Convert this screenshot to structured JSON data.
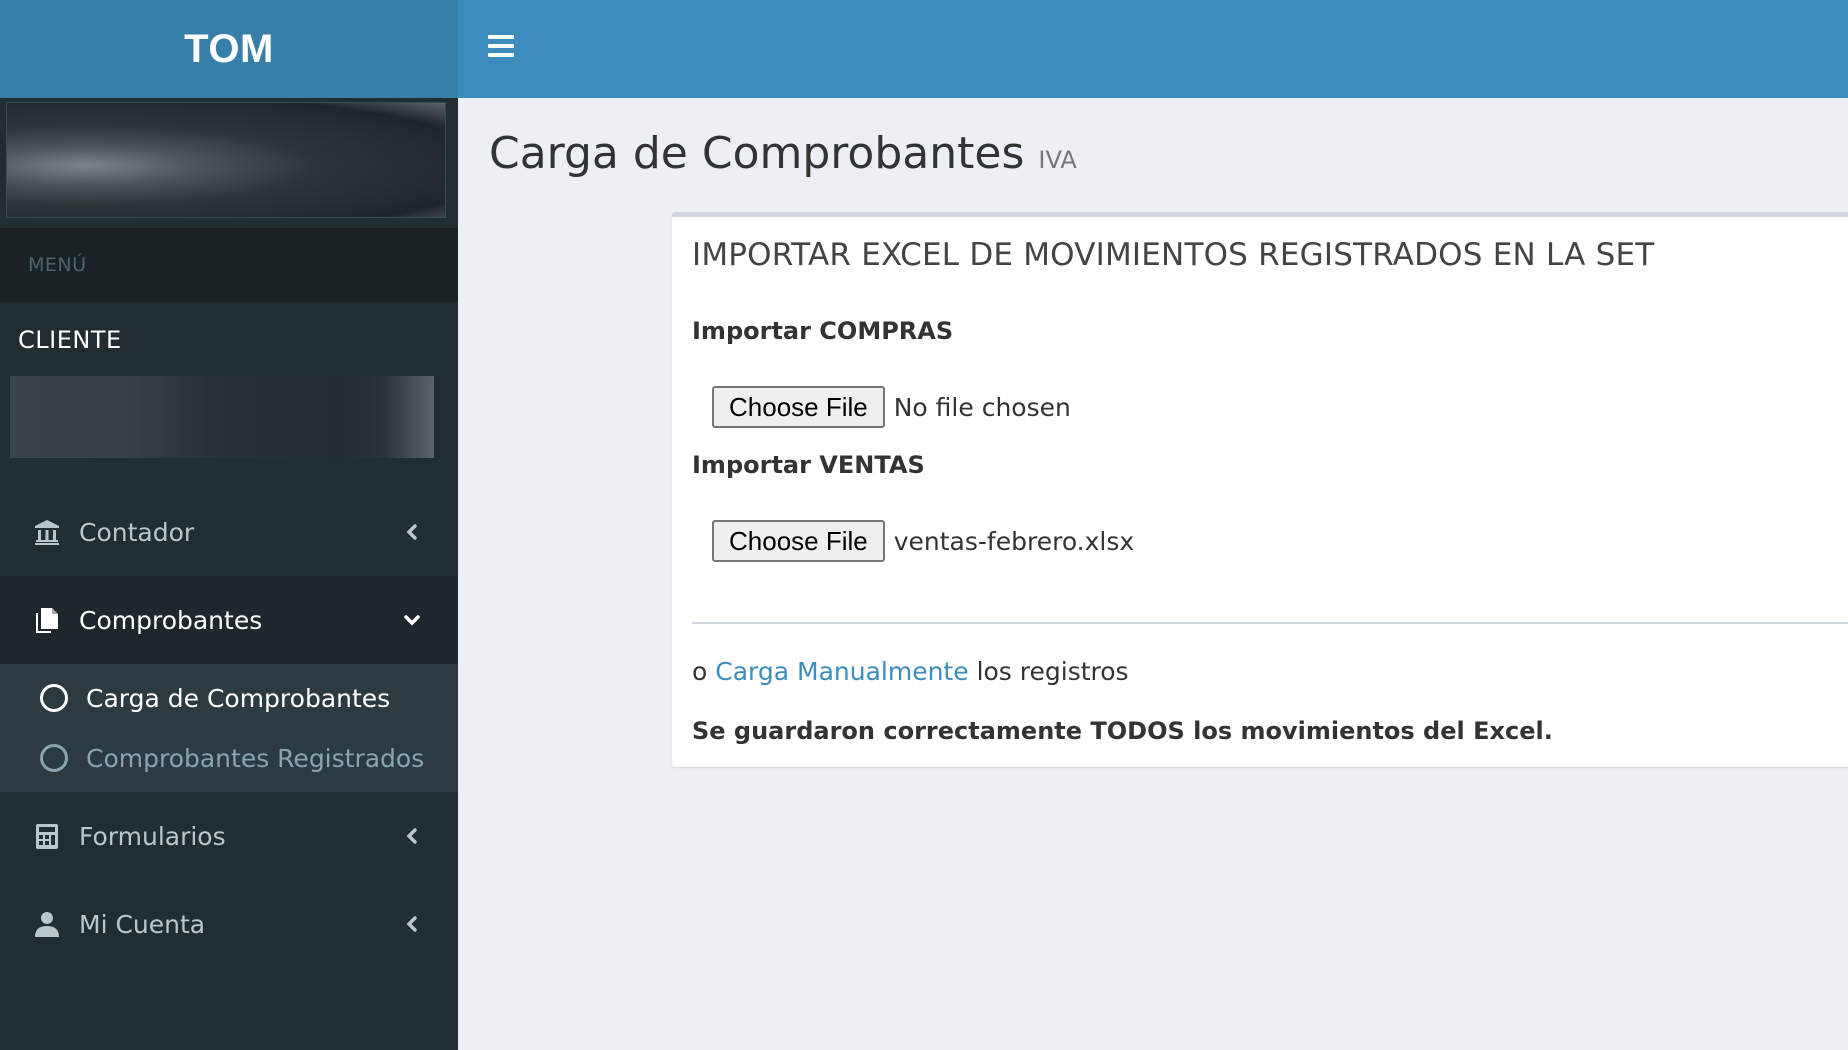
{
  "app": {
    "logo": "TOM"
  },
  "sidebar": {
    "menu_header": "MENÚ",
    "cliente_label": "CLIENTE",
    "items": [
      {
        "label": "Contador",
        "icon": "bank-icon",
        "chevron": "chevron-left-icon",
        "active": false
      },
      {
        "label": "Comprobantes",
        "icon": "files-icon",
        "chevron": "chevron-down-icon",
        "active": true,
        "children": [
          {
            "label": "Carga de Comprobantes",
            "active": true
          },
          {
            "label": "Comprobantes Registrados",
            "active": false
          }
        ]
      },
      {
        "label": "Formularios",
        "icon": "calculator-icon",
        "chevron": "chevron-left-icon",
        "active": false
      },
      {
        "label": "Mi Cuenta",
        "icon": "user-icon",
        "chevron": "chevron-left-icon",
        "active": false
      }
    ]
  },
  "header": {
    "menu_toggle_icon": "hamburger-icon"
  },
  "page": {
    "title": "Carga de Comprobantes",
    "subtitle": "IVA"
  },
  "box": {
    "title": "IMPORTAR EXCEL DE MOVIMIENTOS REGISTRADOS EN LA SET",
    "compras": {
      "label": "Importar COMPRAS",
      "button": "Choose File",
      "file_name": "No file chosen"
    },
    "ventas": {
      "label": "Importar VENTAS",
      "button": "Choose File",
      "file_name": "ventas-febrero.xlsx"
    },
    "manual": {
      "prefix": "o",
      "link": "Carga Manualmente",
      "suffix": "los registros"
    },
    "success_message": "Se guardaron correctamente TODOS los movimientos del Excel."
  },
  "colors": {
    "header": "#3c8dbc",
    "logo_bg": "#367fa9",
    "sidebar": "#222d32",
    "link": "#3c8dbc",
    "content_bg": "#ecf0f5"
  }
}
